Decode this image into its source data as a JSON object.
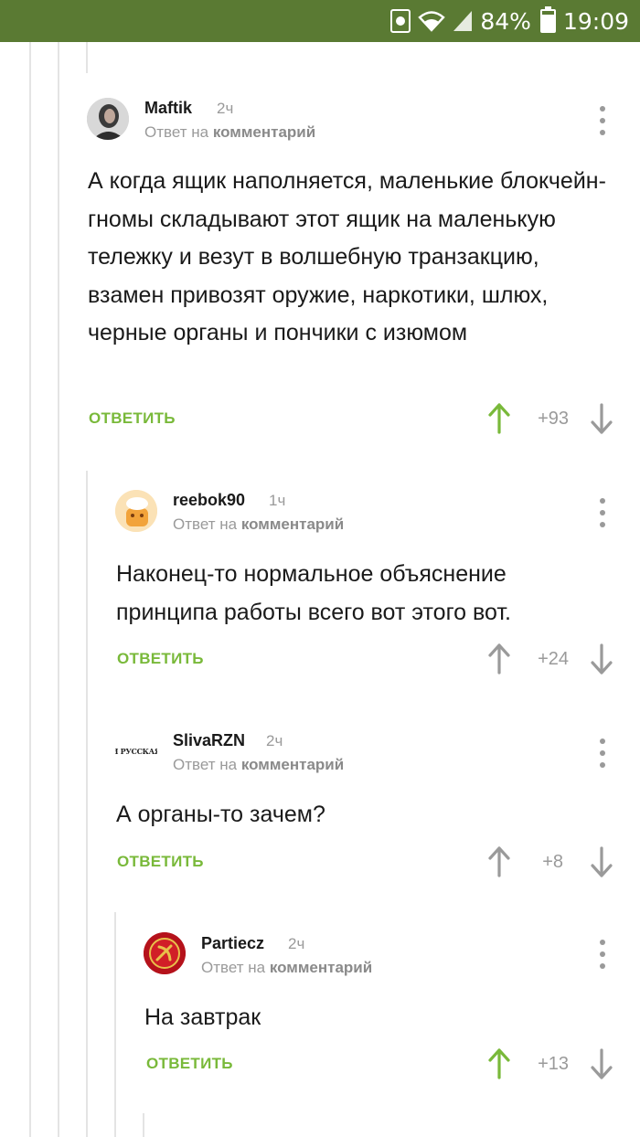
{
  "status_bar": {
    "battery": "84%",
    "time": "19:09"
  },
  "comments": [
    {
      "author": "Maftik",
      "time": "2ч",
      "reply_prefix": "Ответ на",
      "reply_target": "комментарий",
      "text": "А когда ящик наполняется, маленькие блокчейн-гномы складывают этот ящик на маленькую тележку и везут в волшебную транзакцию, взамен привозят оружие, наркотики, шлюх, черные органы и пончики с изюмом",
      "reply_label": "ОТВЕТИТЬ",
      "score": "+93",
      "upvoted": true
    },
    {
      "author": "reebok90",
      "time": "1ч",
      "reply_prefix": "Ответ на",
      "reply_target": "комментарий",
      "text": "Наконец-то нормальное объяснение принципа работы всего вот этого вот.",
      "reply_label": "ОТВЕТИТЬ",
      "score": "+24",
      "upvoted": false
    },
    {
      "author": "SlivaRZN",
      "avatar_text": "Я РУССКАЯ",
      "time": "2ч",
      "reply_prefix": "Ответ на",
      "reply_target": "комментарий",
      "text": "А органы-то зачем?",
      "reply_label": "ОТВЕТИТЬ",
      "score": "+8",
      "upvoted": false
    },
    {
      "author": "Partiecz",
      "time": "2ч",
      "reply_prefix": "Ответ на",
      "reply_target": "комментарий",
      "text": "На завтрак",
      "reply_label": "ОТВЕТИТЬ",
      "score": "+13",
      "upvoted": true
    }
  ],
  "colors": {
    "status_bar": "#5a7a33",
    "accent_green": "#79b93a",
    "muted": "#9a9a9a"
  }
}
